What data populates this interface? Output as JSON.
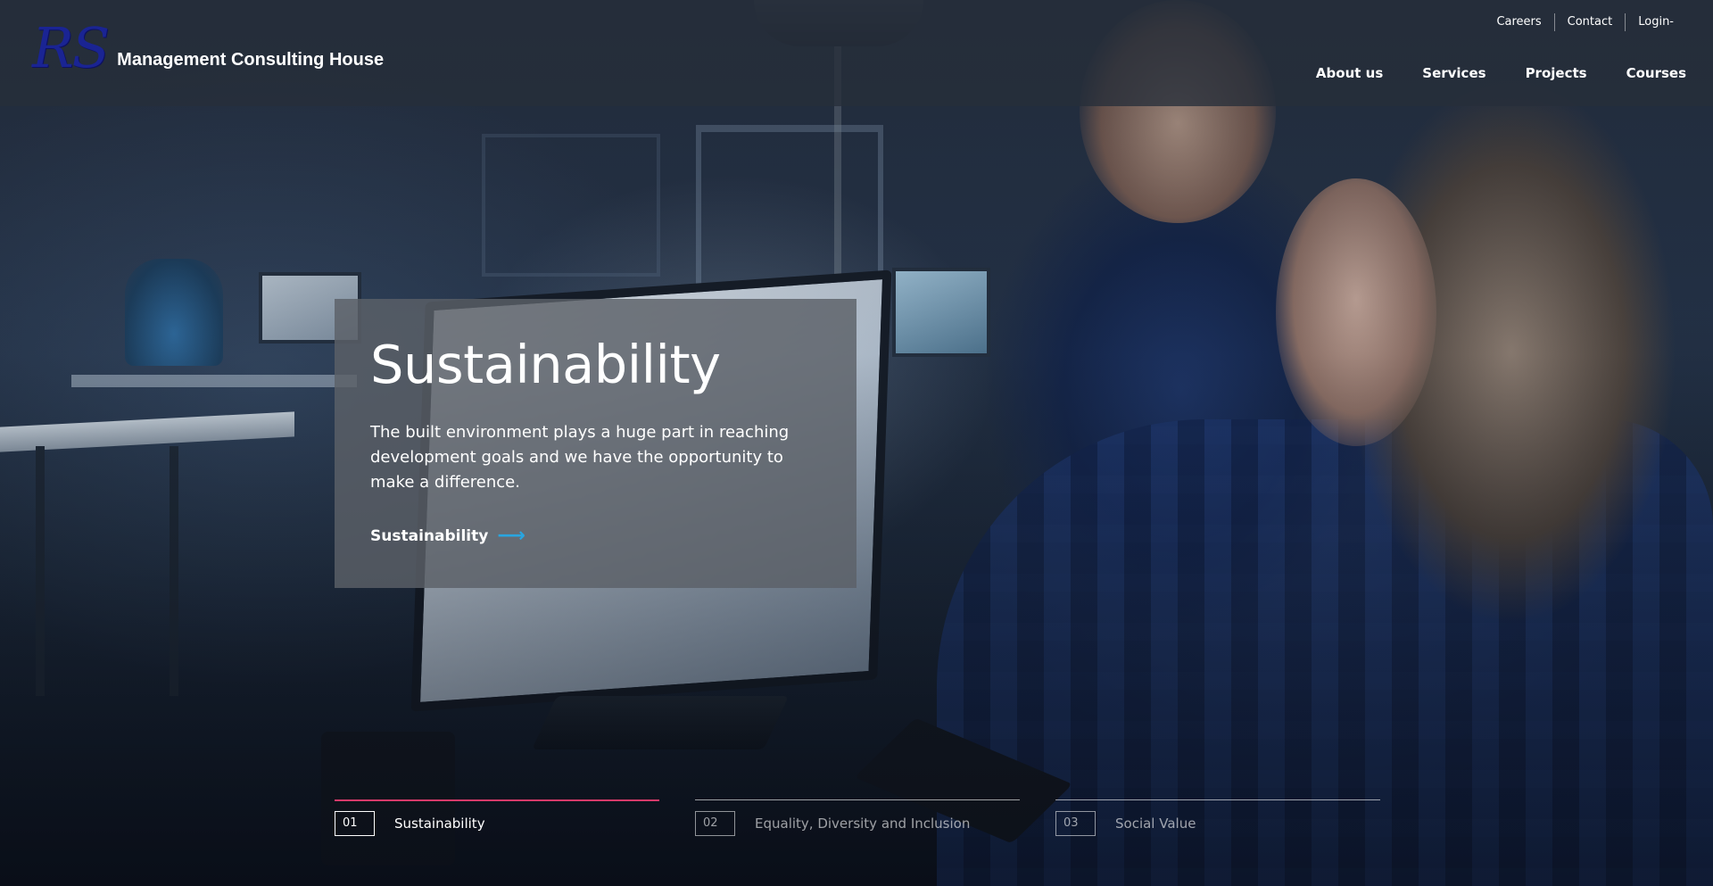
{
  "brand": {
    "logo_mark": "RS",
    "name": "Management Consulting House"
  },
  "utility_nav": [
    {
      "label": "Careers"
    },
    {
      "label": "Contact"
    },
    {
      "label": "Login-"
    }
  ],
  "main_nav": [
    {
      "label": "About us"
    },
    {
      "label": "Services"
    },
    {
      "label": "Projects"
    },
    {
      "label": "Courses"
    }
  ],
  "hero": {
    "title": "Sustainability",
    "text": "The built environment plays a huge part in reaching development goals and we have the opportunity to make a difference.",
    "link_label": "Sustainability",
    "link_icon": "arrow-right-icon"
  },
  "slides": [
    {
      "number": "01",
      "label": "Sustainability",
      "active": true
    },
    {
      "number": "02",
      "label": "Equality, Diversity and Inclusion",
      "active": false
    },
    {
      "number": "03",
      "label": "Social Value",
      "active": false
    }
  ],
  "colors": {
    "accent_arrow": "#29a5e0",
    "active_tab": "#d63a6a",
    "logo_mark": "#1a2493"
  }
}
